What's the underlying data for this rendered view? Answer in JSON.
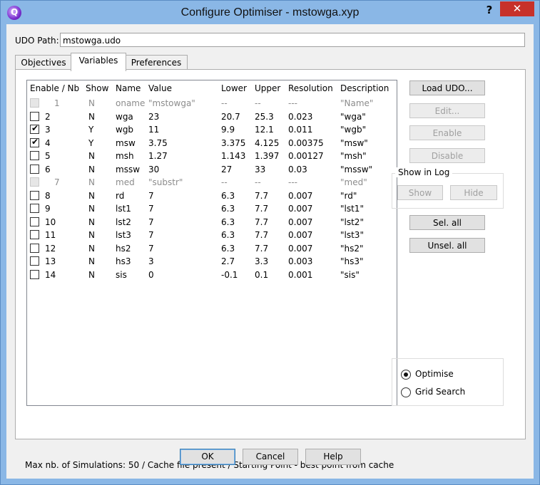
{
  "window": {
    "title": "Configure Optimiser - mstowga.xyp",
    "help_glyph": "?",
    "close_glyph": "✕",
    "app_glyph": "Q"
  },
  "udo": {
    "label": "UDO Path:",
    "value": "mstowga.udo"
  },
  "tabs": [
    {
      "label": "Objectives",
      "active": false
    },
    {
      "label": "Variables",
      "active": true
    },
    {
      "label": "Preferences",
      "active": false
    }
  ],
  "table": {
    "columns": [
      "Enable / Nb",
      "Show",
      "Name",
      "Value",
      "Lower",
      "Upper",
      "Resolution",
      "Description"
    ],
    "rows": [
      {
        "nb": "1",
        "show": "N",
        "name": "oname",
        "value": "\"mstowga\"",
        "lower": "--",
        "upper": "--",
        "resolution": "---",
        "description": "\"Name\"",
        "checked": false,
        "disabled": true
      },
      {
        "nb": "2",
        "show": "N",
        "name": "wga",
        "value": "23",
        "lower": "20.7",
        "upper": "25.3",
        "resolution": "0.023",
        "description": "\"wga\"",
        "checked": false,
        "disabled": false
      },
      {
        "nb": "3",
        "show": "Y",
        "name": "wgb",
        "value": "11",
        "lower": "9.9",
        "upper": "12.1",
        "resolution": "0.011",
        "description": "\"wgb\"",
        "checked": true,
        "disabled": false
      },
      {
        "nb": "4",
        "show": "Y",
        "name": "msw",
        "value": "3.75",
        "lower": "3.375",
        "upper": "4.125",
        "resolution": "0.00375",
        "description": "\"msw\"",
        "checked": true,
        "disabled": false
      },
      {
        "nb": "5",
        "show": "N",
        "name": "msh",
        "value": "1.27",
        "lower": "1.143",
        "upper": "1.397",
        "resolution": "0.00127",
        "description": "\"msh\"",
        "checked": false,
        "disabled": false
      },
      {
        "nb": "6",
        "show": "N",
        "name": "mssw",
        "value": "30",
        "lower": "27",
        "upper": "33",
        "resolution": "0.03",
        "description": "\"mssw\"",
        "checked": false,
        "disabled": false
      },
      {
        "nb": "7",
        "show": "N",
        "name": "med",
        "value": "\"substr\"",
        "lower": "--",
        "upper": "--",
        "resolution": "---",
        "description": "\"med\"",
        "checked": false,
        "disabled": true
      },
      {
        "nb": "8",
        "show": "N",
        "name": "rd",
        "value": "7",
        "lower": "6.3",
        "upper": "7.7",
        "resolution": "0.007",
        "description": "\"rd\"",
        "checked": false,
        "disabled": false
      },
      {
        "nb": "9",
        "show": "N",
        "name": "lst1",
        "value": "7",
        "lower": "6.3",
        "upper": "7.7",
        "resolution": "0.007",
        "description": "\"lst1\"",
        "checked": false,
        "disabled": false
      },
      {
        "nb": "10",
        "show": "N",
        "name": "lst2",
        "value": "7",
        "lower": "6.3",
        "upper": "7.7",
        "resolution": "0.007",
        "description": "\"lst2\"",
        "checked": false,
        "disabled": false
      },
      {
        "nb": "11",
        "show": "N",
        "name": "lst3",
        "value": "7",
        "lower": "6.3",
        "upper": "7.7",
        "resolution": "0.007",
        "description": "\"lst3\"",
        "checked": false,
        "disabled": false
      },
      {
        "nb": "12",
        "show": "N",
        "name": "hs2",
        "value": "7",
        "lower": "6.3",
        "upper": "7.7",
        "resolution": "0.007",
        "description": "\"hs2\"",
        "checked": false,
        "disabled": false
      },
      {
        "nb": "13",
        "show": "N",
        "name": "hs3",
        "value": "3",
        "lower": "2.7",
        "upper": "3.3",
        "resolution": "0.003",
        "description": "\"hs3\"",
        "checked": false,
        "disabled": false
      },
      {
        "nb": "14",
        "show": "N",
        "name": "sis",
        "value": "0",
        "lower": "-0.1",
        "upper": "0.1",
        "resolution": "0.001",
        "description": "\"sis\"",
        "checked": false,
        "disabled": false
      }
    ]
  },
  "side_buttons": {
    "load_udo": "Load UDO...",
    "edit": "Edit...",
    "enable": "Enable",
    "disable": "Disable",
    "show_in_log": "Show in Log",
    "show": "Show",
    "hide": "Hide",
    "sel_all": "Sel. all",
    "unsel_all": "Unsel. all"
  },
  "mode": {
    "optimise": "Optimise",
    "grid_search": "Grid Search",
    "selected": "optimise"
  },
  "status": "Max nb. of Simulations: 50 / Cache file present / Starting Point - best point from cache",
  "footer": {
    "ok": "OK",
    "cancel": "Cancel",
    "help": "Help"
  }
}
